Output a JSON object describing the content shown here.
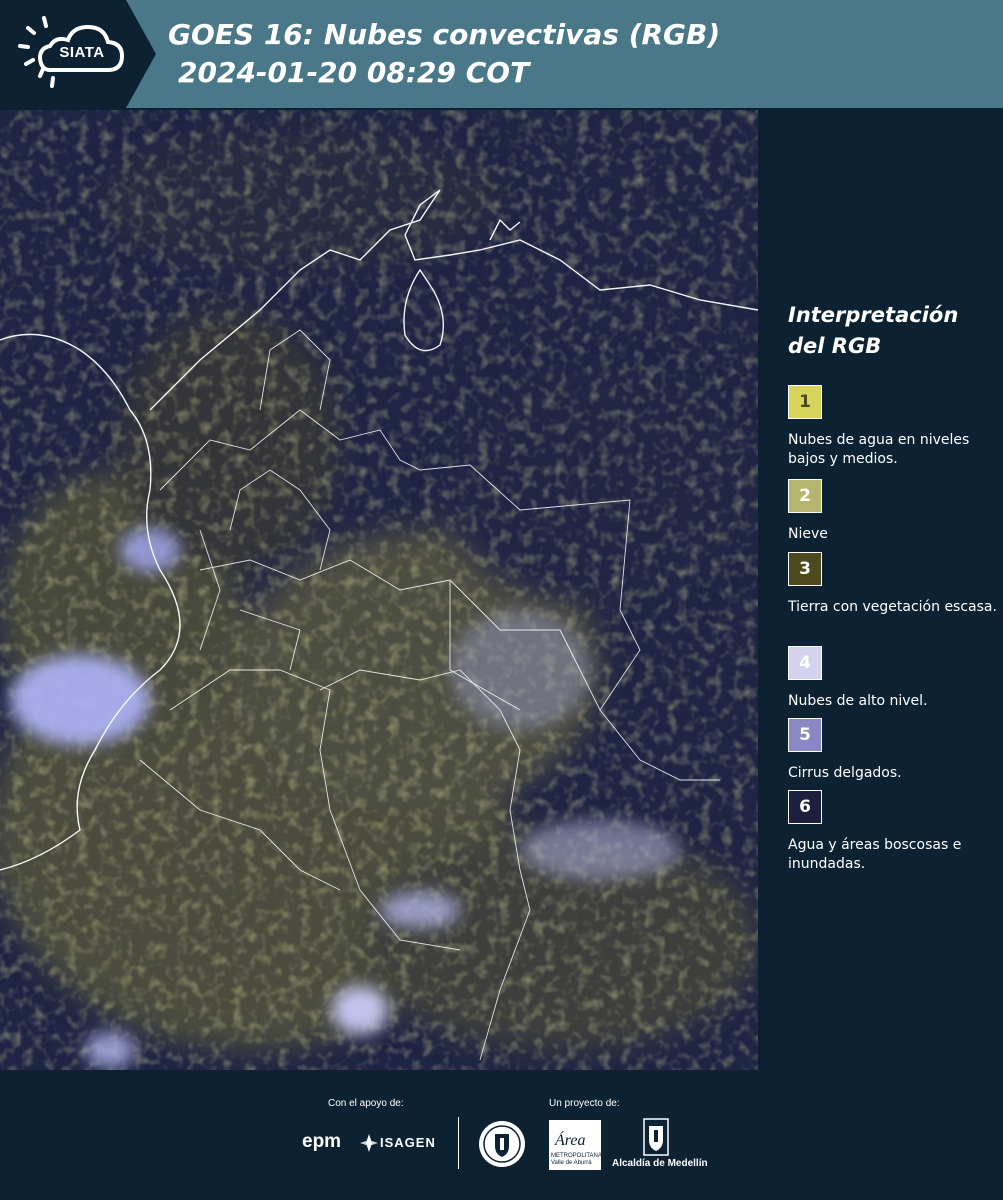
{
  "header": {
    "logo_text": "SIATA",
    "title_line1": "GOES 16: Nubes convectivas (RGB)",
    "title_line2": "2024-01-20 08:29 COT",
    "background_color": "#4a7888"
  },
  "legend": {
    "title_line1": "Interpretación",
    "title_line2": "del RGB",
    "items": [
      {
        "number": "1",
        "label": "Nubes de agua en niveles bajos y medios.",
        "color": "#d6d45a",
        "text_color": "#4a4a20"
      },
      {
        "number": "2",
        "label": "Nieve",
        "color": "#b5b56e",
        "text_color": "#ffffff"
      },
      {
        "number": "3",
        "label": "Tierra con vegetación escasa.",
        "color": "#4d4a20",
        "text_color": "#ffffff"
      },
      {
        "number": "4",
        "label": "Nubes de alto nivel.",
        "color": "#d3d3f0",
        "text_color": "#ffffff"
      },
      {
        "number": "5",
        "label": "Cirrus delgados.",
        "color": "#8a88c2",
        "text_color": "#ffffff"
      },
      {
        "number": "6",
        "label": "Agua y áreas boscosas e inundadas.",
        "color": "#1e1f3e",
        "text_color": "#ffffff"
      }
    ]
  },
  "footer": {
    "support_label": "Con el apoyo de:",
    "project_label": "Un proyecto de:",
    "epm_logo": "epm",
    "isagen_logo": "ISAGEN",
    "area_logo": "Área",
    "area_sub": "METROPOLITANA Valle de Aburrá",
    "alcaldia_logo": "Alcaldía de Medellín"
  }
}
